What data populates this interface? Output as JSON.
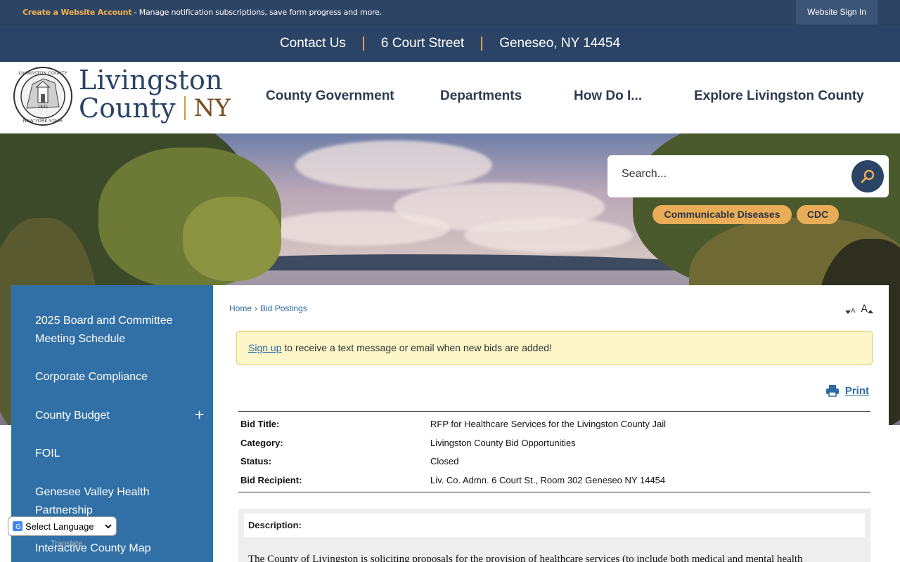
{
  "topbar": {
    "create_account": "Create a Website Account",
    "promo_text": " - Manage notification subscriptions, save form progress and more.",
    "sign_in": "Website Sign In"
  },
  "contact": {
    "items": [
      "Contact Us",
      "6 Court Street",
      "Geneseo, NY 14454"
    ],
    "separator_color": "#e0a24a"
  },
  "logo": {
    "line1": "Livingston",
    "line2": "County",
    "suffix": "NY",
    "seal_top": "LIVINGSTON COUNTY",
    "seal_bottom": "NEW YORK STATE",
    "seal_year": "1821"
  },
  "nav": {
    "items": [
      "County Government",
      "Departments",
      "How Do I...",
      "Explore Livingston County"
    ]
  },
  "search": {
    "placeholder": "Search..."
  },
  "quick_links": [
    "Communicable Diseases",
    "CDC"
  ],
  "sidebar": {
    "items": [
      "2025 Board and Committee Meeting Schedule",
      "Corporate Compliance",
      "County Budget",
      "FOIL",
      "Genesee Valley Health Partnership",
      "Interactive County Map"
    ],
    "expand_symbol": "+"
  },
  "breadcrumb": {
    "home": "Home",
    "separator": "›",
    "current": "Bid Postings"
  },
  "font_controls": {
    "decrease": "A",
    "increase": "A"
  },
  "alert": {
    "link": "Sign up",
    "text": " to receive a text message or email when new bids are added!"
  },
  "print_label": "Print",
  "bid": {
    "rows": [
      {
        "label": "Bid Title:",
        "value": "RFP for Healthcare Services for the Livingston County Jail"
      },
      {
        "label": "Category:",
        "value": "Livingston County Bid Opportunities"
      },
      {
        "label": "Status:",
        "value": "Closed"
      },
      {
        "label": "Bid Recipient:",
        "value": "Liv. Co. Admn. 6 Court St., Room 302 Geneseo NY 14454"
      }
    ]
  },
  "description": {
    "label": "Description:",
    "text": "The County of Livingston is soliciting proposals for the provision of healthcare services (to include both medical and mental health"
  },
  "translate": {
    "label": "Select Language",
    "powered": "Translate"
  },
  "colors": {
    "navy": "#2b4465",
    "gold": "#e9ad58",
    "sidebar_blue": "#3170a6",
    "link_blue": "#2d6aa5"
  }
}
